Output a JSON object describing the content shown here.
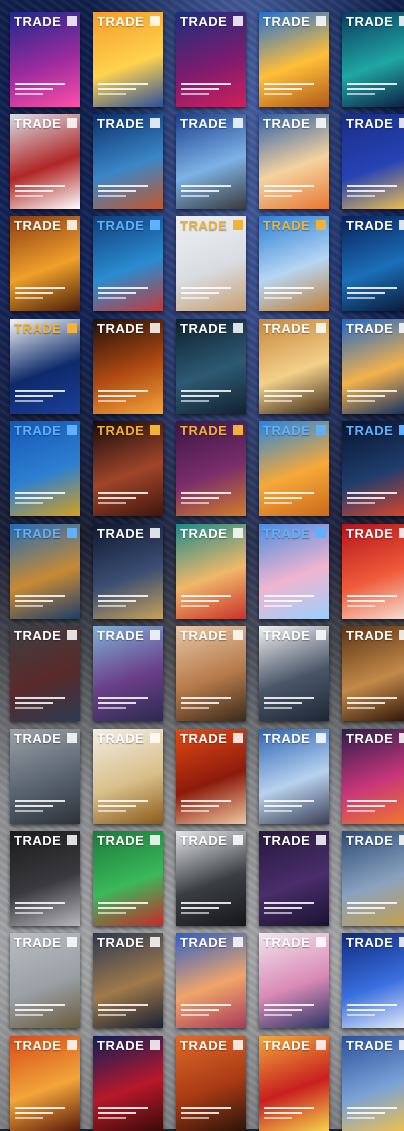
{
  "masthead": "TRADE",
  "covers": [
    {
      "g": [
        "#1b2a8a",
        "#9b2b9e",
        "#ff4fa8"
      ],
      "t": "white"
    },
    {
      "g": [
        "#f59a2a",
        "#ffd34d",
        "#2a4f9a"
      ],
      "t": "white"
    },
    {
      "g": [
        "#1a2f7c",
        "#7b1c6f",
        "#d11f5a"
      ],
      "t": "white"
    },
    {
      "g": [
        "#1e6fd6",
        "#ffbf39",
        "#b05a1b"
      ],
      "t": "white"
    },
    {
      "g": [
        "#0a3a5e",
        "#1fa7a3",
        "#0d1a40"
      ],
      "t": "white"
    },
    {
      "g": [
        "#d8dfe6",
        "#b02626",
        "#ffffff"
      ],
      "t": "white"
    },
    {
      "g": [
        "#0a2e6b",
        "#3b87c7",
        "#c5562a"
      ],
      "t": "white"
    },
    {
      "g": [
        "#1a3f8c",
        "#7db2e6",
        "#3a3a3a"
      ],
      "t": "white"
    },
    {
      "g": [
        "#2a5ea8",
        "#f5d3a0",
        "#e57833"
      ],
      "t": "white"
    },
    {
      "g": [
        "#1a2d85",
        "#2643b5",
        "#f4c44a"
      ],
      "t": "white"
    },
    {
      "g": [
        "#8a3c14",
        "#f0a02a",
        "#4a1f0a"
      ],
      "t": "white"
    },
    {
      "g": [
        "#0f3d7a",
        "#2a8cd0",
        "#c23a3a"
      ],
      "t": "blue"
    },
    {
      "g": [
        "#eef0f2",
        "#d9dde3",
        "#c7a072"
      ],
      "t": "gold"
    },
    {
      "g": [
        "#2a7fd6",
        "#b6d6f2",
        "#c0803a"
      ],
      "t": "gold"
    },
    {
      "g": [
        "#09205a",
        "#1b6fb8",
        "#0a1633"
      ],
      "t": "white"
    },
    {
      "g": [
        "#f4f6f8",
        "#0d2a6a",
        "#1b3f9b"
      ],
      "t": "gold"
    },
    {
      "g": [
        "#201008",
        "#b04a12",
        "#f5a53a"
      ],
      "t": "white"
    },
    {
      "g": [
        "#0d1f2e",
        "#2d5a72",
        "#11222f"
      ],
      "t": "white"
    },
    {
      "g": [
        "#c6863a",
        "#f3d08a",
        "#3a2716"
      ],
      "t": "white"
    },
    {
      "g": [
        "#1d67c7",
        "#f4b24c",
        "#0a2c63"
      ],
      "t": "white"
    },
    {
      "g": [
        "#1457b5",
        "#2d7fd1",
        "#d7a01b"
      ],
      "t": "blue"
    },
    {
      "g": [
        "#150b0b",
        "#a0452a",
        "#40160c"
      ],
      "t": "gold"
    },
    {
      "g": [
        "#3a1747",
        "#7a2d6a",
        "#d27d2a"
      ],
      "t": "gold"
    },
    {
      "g": [
        "#2486e0",
        "#f7a938",
        "#c96a1d"
      ],
      "t": "blue"
    },
    {
      "g": [
        "#07142e",
        "#1f3d6c",
        "#e0462a"
      ],
      "t": "blue"
    },
    {
      "g": [
        "#1f6bb8",
        "#c88a34",
        "#1d3e6b"
      ],
      "t": "blue"
    },
    {
      "g": [
        "#0f1930",
        "#3b4e73",
        "#c7a15a"
      ],
      "t": "white"
    },
    {
      "g": [
        "#1b8a8a",
        "#f0b86a",
        "#c9312a"
      ],
      "t": "white"
    },
    {
      "g": [
        "#4a8de0",
        "#f0b5cf",
        "#9ad0ff"
      ],
      "t": "blue"
    },
    {
      "g": [
        "#b3141c",
        "#f05a3a",
        "#f4e4d8"
      ],
      "t": "white"
    },
    {
      "g": [
        "#3d3f43",
        "#5a2a2a",
        "#2a3b52"
      ],
      "t": "white"
    },
    {
      "g": [
        "#7fb2d6",
        "#6a3f8a",
        "#2b2b4e"
      ],
      "t": "white"
    },
    {
      "g": [
        "#e8c7a6",
        "#b67a4a",
        "#3a2a1a"
      ],
      "t": "white"
    },
    {
      "g": [
        "#f2f2f2",
        "#4a5668",
        "#1d2635"
      ],
      "t": "white"
    },
    {
      "g": [
        "#5b3214",
        "#c28a4a",
        "#2a1206"
      ],
      "t": "white"
    },
    {
      "g": [
        "#9aa1a8",
        "#5a6470",
        "#2c3238"
      ],
      "t": "white"
    },
    {
      "g": [
        "#f2ede4",
        "#d9c08a",
        "#8a5a1a"
      ],
      "t": "white"
    },
    {
      "g": [
        "#e24a14",
        "#8c1b0c",
        "#f0c7a0"
      ],
      "t": "white"
    },
    {
      "g": [
        "#2a64b5",
        "#b8d2ee",
        "#3b3f55"
      ],
      "t": "white"
    },
    {
      "g": [
        "#2a1d4a",
        "#c8367a",
        "#f27a2a"
      ],
      "t": "white"
    },
    {
      "g": [
        "#1b1b1d",
        "#3a3a3e",
        "#b8b8bc"
      ],
      "t": "white"
    },
    {
      "g": [
        "#1a7a3a",
        "#3bb85a",
        "#c8282a"
      ],
      "t": "white"
    },
    {
      "g": [
        "#e4e6e9",
        "#3a3d42",
        "#15171a"
      ],
      "t": "white"
    },
    {
      "g": [
        "#241a3e",
        "#4a2d6a",
        "#1a1230"
      ],
      "t": "white"
    },
    {
      "g": [
        "#2b4a73",
        "#8aa2bf",
        "#c7a048"
      ],
      "t": "white"
    },
    {
      "g": [
        "#b9bdc2",
        "#9aa0a6",
        "#6a5a3a"
      ],
      "t": "white"
    },
    {
      "g": [
        "#2a3752",
        "#a07a4a",
        "#1a2033"
      ],
      "t": "white"
    },
    {
      "g": [
        "#2d5fc7",
        "#f0a56a",
        "#a83a5a"
      ],
      "t": "white"
    },
    {
      "g": [
        "#f3e5ee",
        "#d98ab6",
        "#2a3566"
      ],
      "t": "white"
    },
    {
      "g": [
        "#0f2a7a",
        "#3a6fe0",
        "#e9eef8"
      ],
      "t": "white"
    },
    {
      "g": [
        "#d44a1a",
        "#f3a53a",
        "#5a1a0a"
      ],
      "t": "white"
    },
    {
      "g": [
        "#0d1e5a",
        "#b8182a",
        "#3a0a0a"
      ],
      "t": "white"
    },
    {
      "g": [
        "#e06a2a",
        "#a83a14",
        "#2a140a"
      ],
      "t": "white"
    },
    {
      "g": [
        "#f2a93a",
        "#c81f1f",
        "#f4d24a"
      ],
      "t": "white"
    },
    {
      "g": [
        "#2a4f9a",
        "#7aa2d6",
        "#f0c24a"
      ],
      "t": "white"
    }
  ]
}
